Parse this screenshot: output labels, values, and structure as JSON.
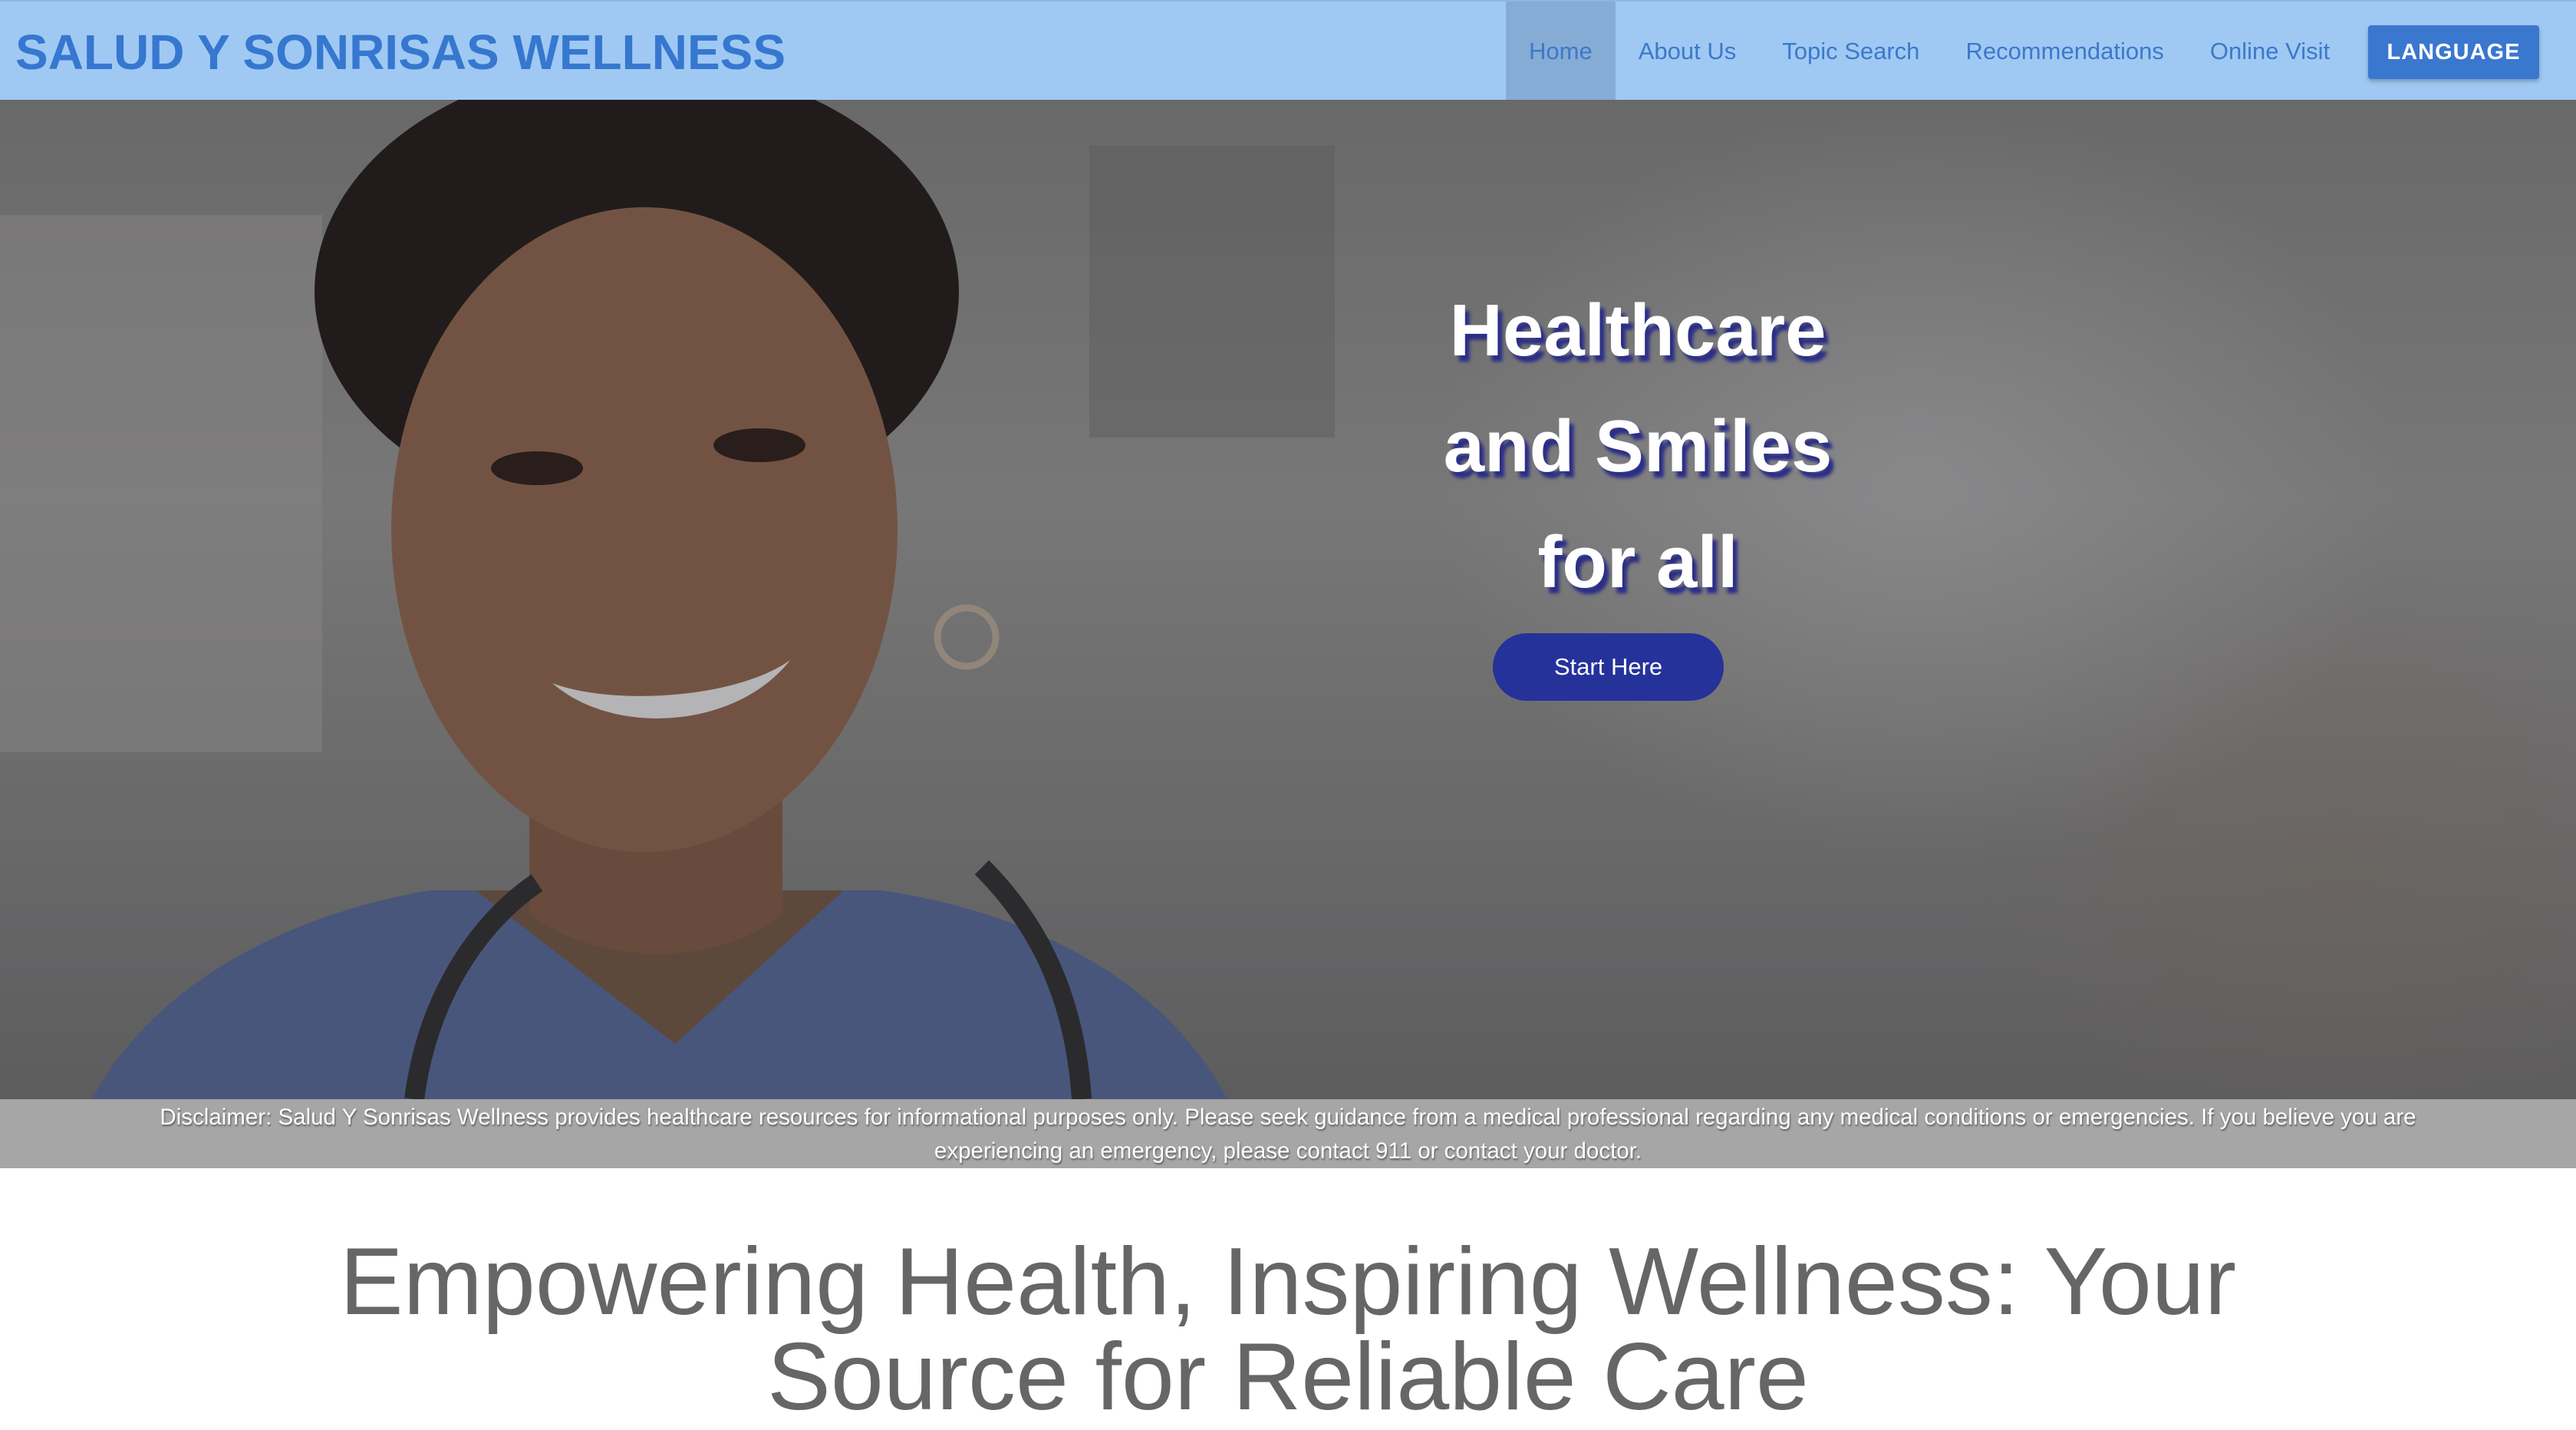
{
  "header": {
    "brand": "SALUD Y SONRISAS WELLNESS",
    "nav": [
      {
        "label": "Home",
        "active": true
      },
      {
        "label": "About Us",
        "active": false
      },
      {
        "label": "Topic Search",
        "active": false
      },
      {
        "label": "Recommendations",
        "active": false
      },
      {
        "label": "Online Visit",
        "active": false
      }
    ],
    "language_button": "LANGUAGE"
  },
  "hero": {
    "title_line1": "Healthcare",
    "title_line2": "and Smiles",
    "title_line3": "for all",
    "cta_label": "Start Here",
    "image_subject": "smiling healthcare worker with stethoscope"
  },
  "disclaimer": "Disclaimer: Salud Y Sonrisas Wellness provides healthcare resources for informational purposes only. Please seek guidance from a medical professional regarding any medical conditions or emergencies. If you believe you are experiencing an emergency, please contact 911 or contact your doctor.",
  "main": {
    "tagline": "Empowering Health, Inspiring Wellness: Your Source for Reliable Care"
  },
  "colors": {
    "navbar": "#9fc9f3",
    "brand": "#3677cf",
    "nav_active": "#86acd5",
    "language_button": "#3a77cf",
    "cta_button": "#25329a",
    "disclaimer_bar": "#a6a6a6",
    "tagline_text": "#666666"
  }
}
